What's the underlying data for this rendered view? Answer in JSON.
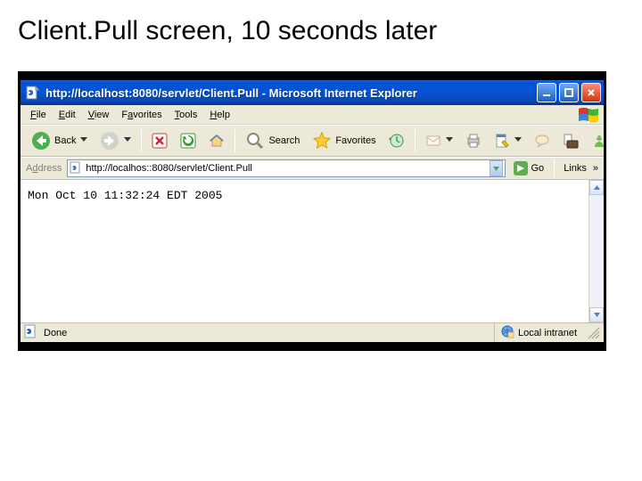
{
  "slide_title": "Client.Pull screen, 10 seconds later",
  "window": {
    "title": "http://localhost:8080/servlet/Client.Pull - Microsoft Internet Explorer"
  },
  "menu": {
    "file": "File",
    "edit": "Edit",
    "view": "View",
    "favorites": "Favorites",
    "tools": "Tools",
    "help": "Help"
  },
  "toolbar": {
    "back": "Back",
    "search": "Search",
    "favorites": "Favorites"
  },
  "address": {
    "label": "Address",
    "url": "http://localhos::8080/servlet/Client.Pull",
    "go": "Go",
    "links": "Links"
  },
  "page_body": "Mon Oct 10 11:32:24 EDT 2005",
  "status": {
    "text": "Done",
    "zone": "Local intranet"
  }
}
